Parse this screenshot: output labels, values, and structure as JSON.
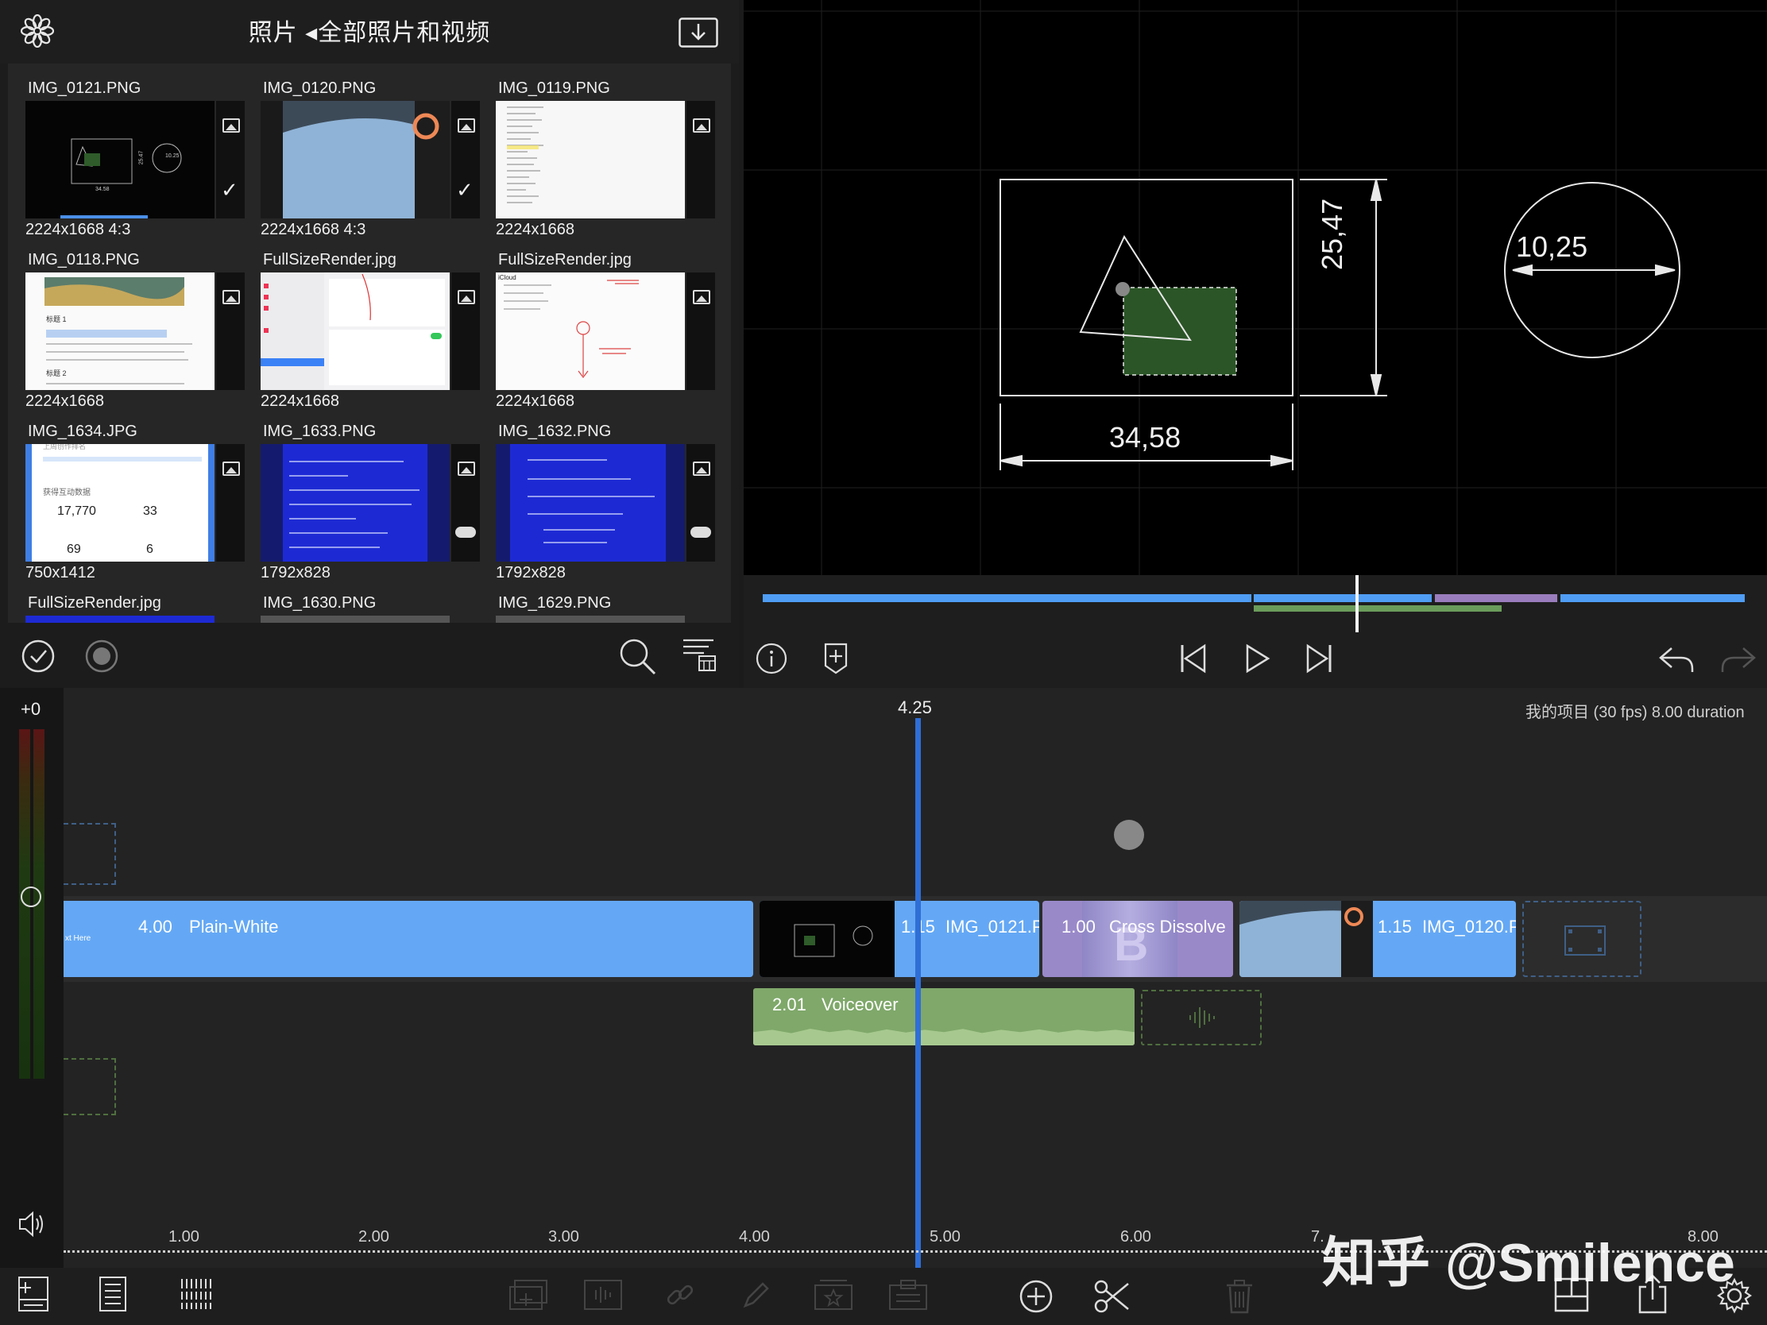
{
  "media": {
    "title": "照片 ◂全部照片和视频",
    "items": [
      {
        "name": "IMG_0121.PNG",
        "dims": "2224x1668  4:3",
        "checked": true
      },
      {
        "name": "IMG_0120.PNG",
        "dims": "2224x1668  4:3",
        "checked": true
      },
      {
        "name": "IMG_0119.PNG",
        "dims": "2224x1668",
        "checked": false
      },
      {
        "name": "IMG_0118.PNG",
        "dims": "2224x1668",
        "checked": false
      },
      {
        "name": "FullSizeRender.jpg",
        "dims": "2224x1668",
        "checked": false
      },
      {
        "name": "FullSizeRender.jpg",
        "dims": "2224x1668",
        "checked": false
      },
      {
        "name": "IMG_1634.JPG",
        "dims": "750x1412",
        "checked": false
      },
      {
        "name": "IMG_1633.PNG",
        "dims": "1792x828",
        "checked": false
      },
      {
        "name": "IMG_1632.PNG",
        "dims": "1792x828",
        "checked": false
      },
      {
        "name": "FullSizeRender.jpg",
        "dims": "",
        "checked": false
      },
      {
        "name": "IMG_1630.PNG",
        "dims": "",
        "checked": false
      },
      {
        "name": "IMG_1629.PNG",
        "dims": "",
        "checked": false
      }
    ]
  },
  "preview": {
    "dim_width": "34,58",
    "dim_height": "25,47",
    "dim_radius": "10,25"
  },
  "timeline": {
    "offset_label": "+0",
    "playhead_time": "4.25",
    "project_info": "我的项目 (30 fps)  8.00 duration",
    "clips": {
      "title_clip": {
        "duration": "4.00",
        "name": "Plain-White",
        "subtext": "xt Here"
      },
      "clip1": {
        "duration": "1.15",
        "name": "IMG_0121.P"
      },
      "transition": {
        "duration": "1.00",
        "name": "Cross Dissolve"
      },
      "clip2": {
        "duration": "1.15",
        "name": "IMG_0120.P"
      },
      "voiceover": {
        "duration": "2.01",
        "name": "Voiceover"
      }
    },
    "ticks": [
      "1.00",
      "2.00",
      "3.00",
      "4.00",
      "5.00",
      "6.00",
      "7.",
      "8.00"
    ]
  },
  "thumb_texts": {
    "t1_w": "34.58",
    "t1_h": "25.47",
    "t1_r": "10.25",
    "t4_heading": "标题 1",
    "t4_heading2": "标题 2",
    "t6_label": "iCloud",
    "t7_title": "上周创作排名",
    "t7_subtitle": "获得互动数据",
    "t7_n1": "17,770",
    "t7_n2": "33",
    "t7_n3": "69",
    "t7_n4": "6"
  },
  "watermark": "知乎 @Smilence",
  "colors": {
    "clip_blue": "#64a8f5",
    "transition_purple": "#9a89c9",
    "audio_green": "#7fa86a",
    "playhead": "#2f6ed6"
  }
}
